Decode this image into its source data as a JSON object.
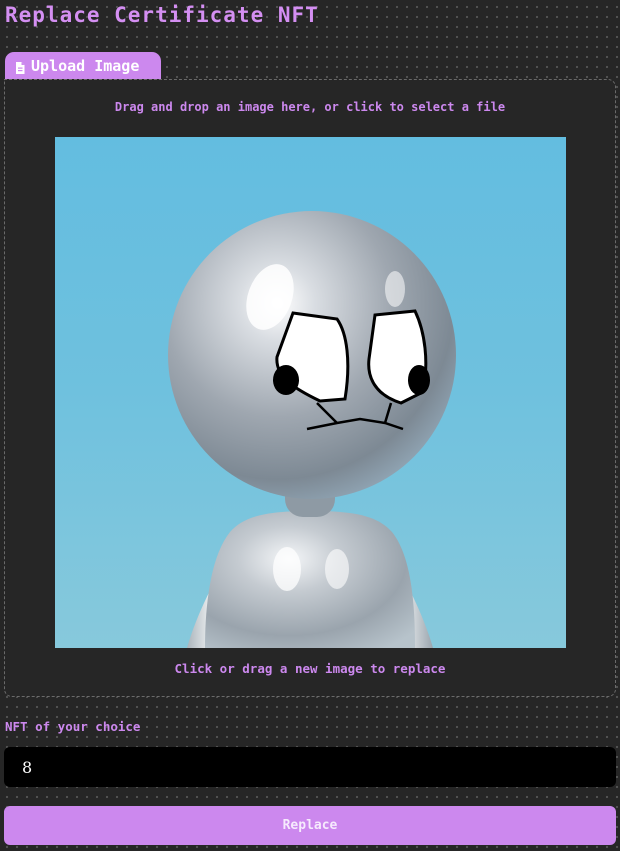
{
  "page": {
    "title": "Replace Certificate NFT"
  },
  "tab": {
    "icon": "file-icon",
    "label": "Upload Image"
  },
  "upload": {
    "drop_hint": "Drag and drop an image here, or click to select a file",
    "replace_hint": "Click or drag a new image to replace",
    "preview_subject": "chrome-figure-image"
  },
  "form": {
    "nft_label": "NFT of your choice",
    "nft_value": "8",
    "submit_label": "Replace"
  },
  "colors": {
    "background": "#262626",
    "accent": "#cc88ee",
    "panel": "#262626",
    "input_background": "#000000",
    "sky_top": "#63bde0",
    "sky_bottom": "#87c9dc"
  }
}
